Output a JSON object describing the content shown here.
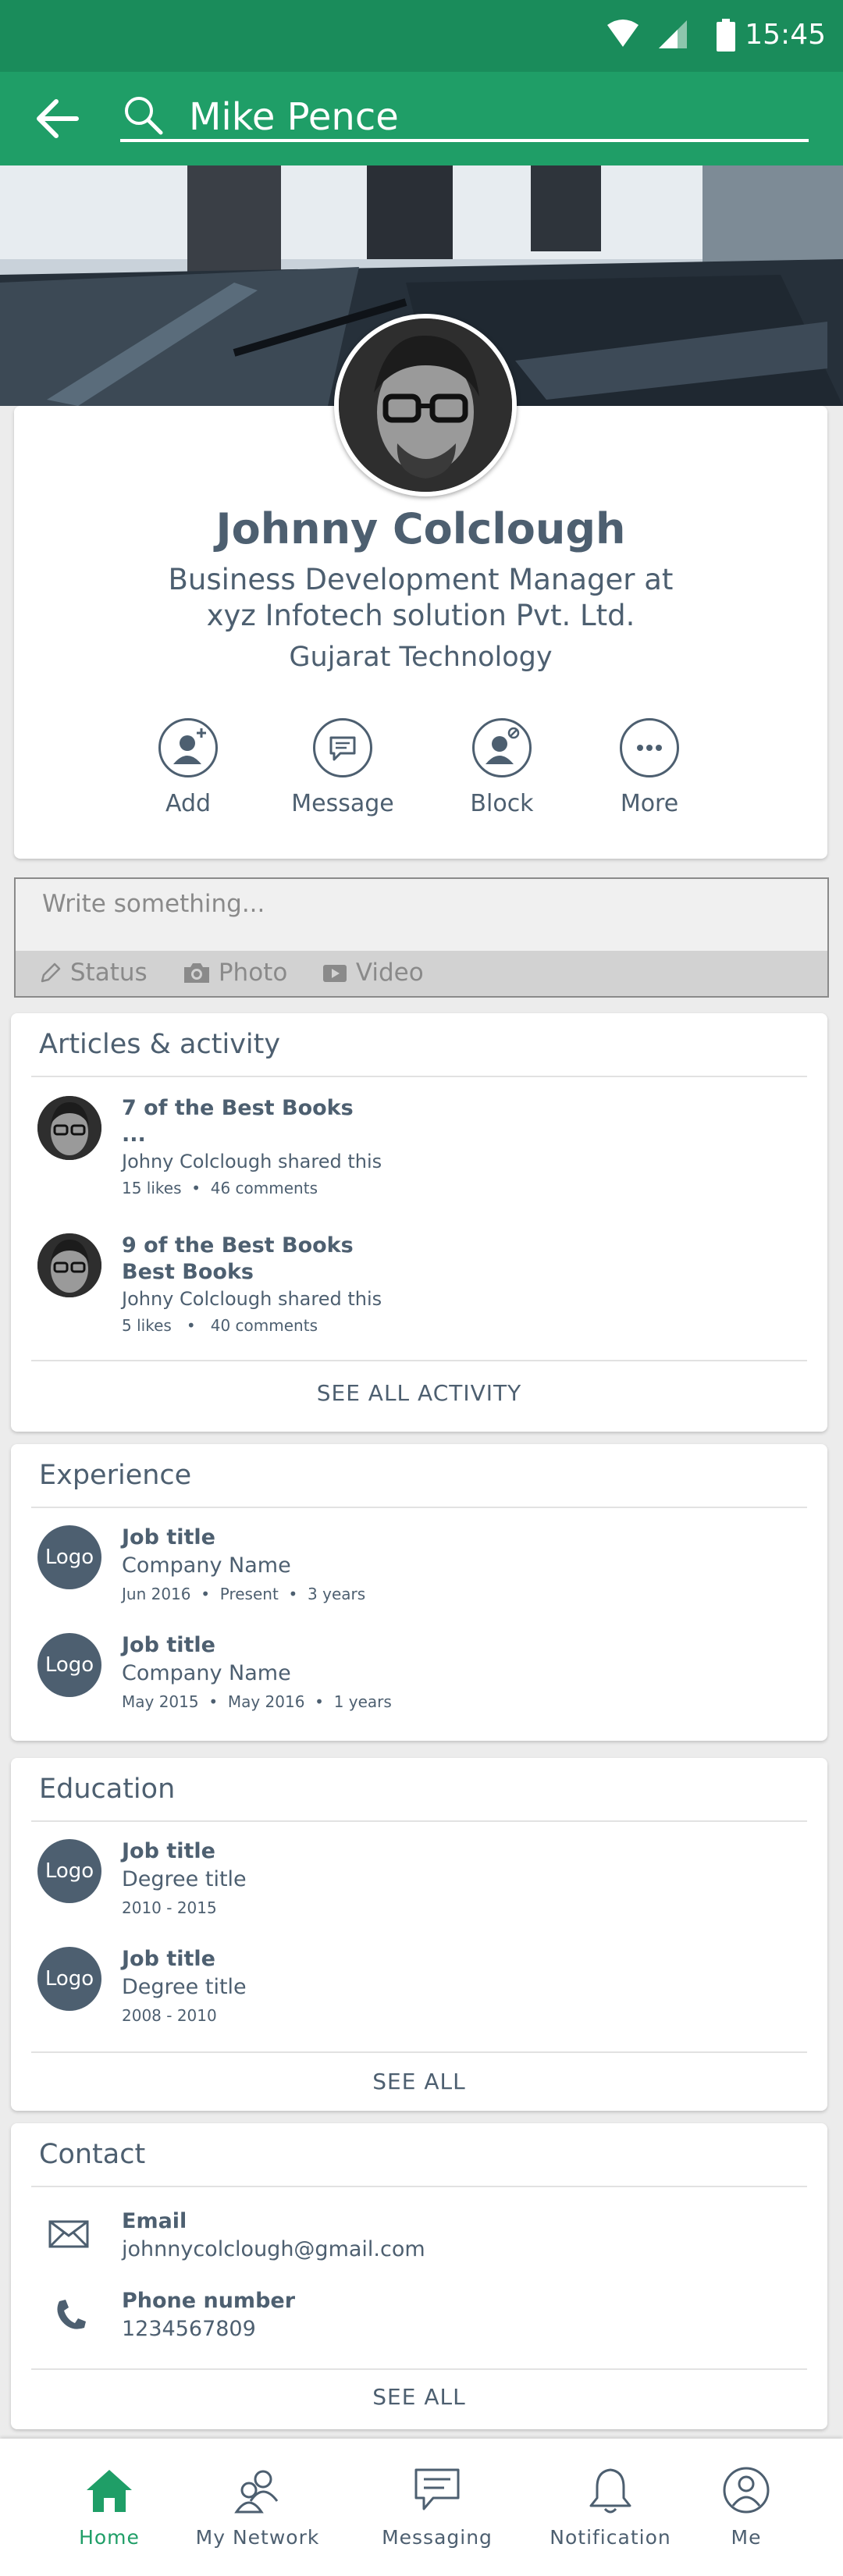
{
  "status_bar": {
    "time": "15:45"
  },
  "search": {
    "value": "Mike Pence"
  },
  "profile": {
    "name": "Johnny Colclough",
    "title_line1": "Business Development Manager at",
    "title_line2": "xyz Infotech solution Pvt. Ltd.",
    "org": "Gujarat Technology",
    "actions": [
      {
        "label": "Add",
        "icon": "add-person-icon"
      },
      {
        "label": "Message",
        "icon": "message-icon"
      },
      {
        "label": "Block",
        "icon": "block-person-icon"
      },
      {
        "label": "More",
        "icon": "more-icon"
      }
    ]
  },
  "composer": {
    "placeholder": "Write something...",
    "tools": [
      {
        "label": "Status",
        "icon": "pencil-icon"
      },
      {
        "label": "Photo",
        "icon": "camera-icon"
      },
      {
        "label": "Video",
        "icon": "video-icon"
      }
    ]
  },
  "articles": {
    "title": "Articles & activity",
    "items": [
      {
        "title_line1": "7 of the Best Books",
        "title_line2": "...",
        "shared": "Johny Colclough shared this",
        "likes": "15 likes",
        "comments": "46 comments"
      },
      {
        "title_line1": "9 of the Best Books",
        "title_line2": "Best Books",
        "shared": "Johny Colclough shared this",
        "likes": "5 likes",
        "comments": "40 comments"
      }
    ],
    "see_all": "SEE ALL ACTIVITY"
  },
  "experience": {
    "title": "Experience",
    "items": [
      {
        "logo": "Logo",
        "job": "Job title",
        "company": "Company Name",
        "start": "Jun 2016",
        "end": "Present",
        "duration": "3 years"
      },
      {
        "logo": "Logo",
        "job": "Job title",
        "company": "Company Name",
        "start": "May 2015",
        "end": "May 2016",
        "duration": "1 years"
      }
    ]
  },
  "education": {
    "title": "Education",
    "items": [
      {
        "logo": "Logo",
        "job": "Job title",
        "degree": "Degree title",
        "years": "2010 - 2015"
      },
      {
        "logo": "Logo",
        "job": "Job title",
        "degree": "Degree title",
        "years": "2008 - 2010"
      }
    ],
    "see_all": "SEE ALL"
  },
  "contact": {
    "title": "Contact",
    "email_label": "Email",
    "email": "johnnycolclough@gmail.com",
    "phone_label": "Phone number",
    "phone": "1234567809",
    "see_all": "SEE ALL"
  },
  "bottom_nav": [
    {
      "label": "Home",
      "icon": "home-icon",
      "active": true
    },
    {
      "label": "My Network",
      "icon": "network-icon"
    },
    {
      "label": "Messaging",
      "icon": "messaging-icon"
    },
    {
      "label": "Notification",
      "icon": "bell-icon"
    },
    {
      "label": "Me",
      "icon": "profile-icon"
    }
  ],
  "colors": {
    "primary": "#1f9e67",
    "status_bar": "#1a8c5b",
    "text": "#4d5f70"
  }
}
